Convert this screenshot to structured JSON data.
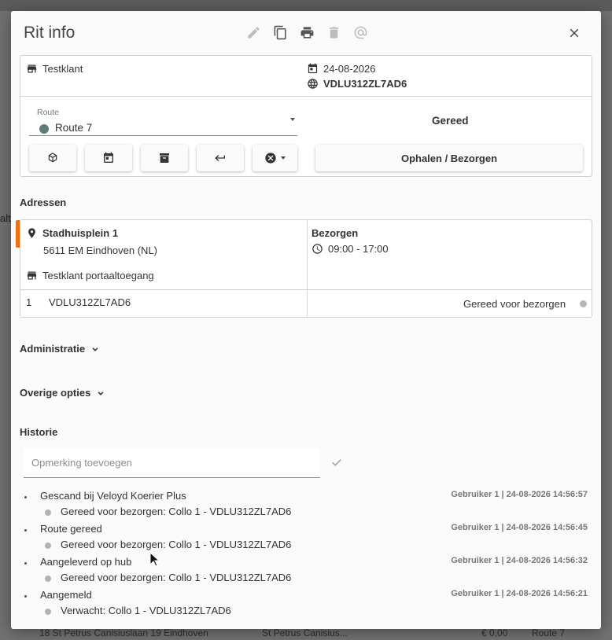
{
  "backdrop": {
    "left_fragment": "alt",
    "bottom_row": [
      "18 St Petrus Canisiuslaan 19 Eindhoven",
      "St Petrus Canisius...",
      "€ 0,00",
      "Route 7"
    ]
  },
  "dialog": {
    "title": "Rit info",
    "toolbar_icons": [
      "edit-icon",
      "copy-icon",
      "print-icon",
      "delete-icon",
      "email-icon"
    ],
    "close_icon": "close-icon"
  },
  "info": {
    "customer": "Testklant",
    "date": "24-08-2026",
    "tracking": "VDLU312ZL7AD6",
    "route_label": "Route",
    "route_value": "Route 7",
    "route_color": "#607d78",
    "status": "Gereed",
    "action_button": "Ophalen / Bezorgen"
  },
  "addresses": {
    "heading": "Adressen",
    "street": "Stadhuisplein 1",
    "city": "5611 EM Eindhoven (NL)",
    "contact": "Testklant portaaltoegang",
    "type": "Bezorgen",
    "window": "09:00 - 17:00",
    "accent_color": "#e8731a",
    "collo_index": "1",
    "collo_code": "VDLU312ZL7AD6",
    "collo_status": "Gereed voor bezorgen"
  },
  "sections": {
    "administratie": "Administratie",
    "overige": "Overige opties",
    "historie": "Historie"
  },
  "remark": {
    "placeholder": "Opmerking toevoegen",
    "value": ""
  },
  "history": [
    {
      "event": "Gescand bij Veloyd Koerier Plus",
      "detail": "Gereed voor bezorgen: Collo 1 - VDLU312ZL7AD6",
      "meta": "Gebruiker 1 | 24-08-2026 14:56:57"
    },
    {
      "event": "Route gereed",
      "detail": "Gereed voor bezorgen: Collo 1 - VDLU312ZL7AD6",
      "meta": "Gebruiker 1 | 24-08-2026 14:56:45"
    },
    {
      "event": "Aangeleverd op hub",
      "detail": "Gereed voor bezorgen: Collo 1 - VDLU312ZL7AD6",
      "meta": "Gebruiker 1 | 24-08-2026 14:56:32"
    },
    {
      "event": "Aangemeld",
      "detail": "Verwacht: Collo 1 - VDLU312ZL7AD6",
      "meta": "Gebruiker 1 | 24-08-2026 14:56:21"
    }
  ]
}
